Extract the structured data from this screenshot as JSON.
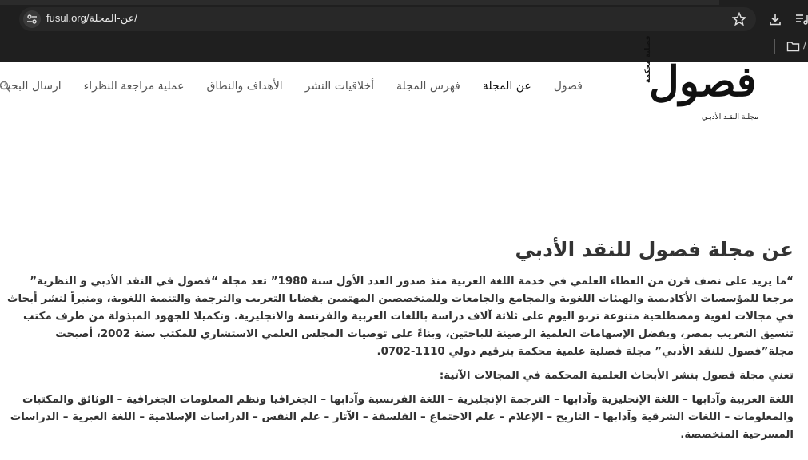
{
  "browser": {
    "url": "fusul.org/عن-المجلة/",
    "bookmark_bar_partial": "/"
  },
  "site": {
    "logo": {
      "word": "فصول",
      "badge": "فصلية محكمة",
      "subtitle": "مجلـة النقـد الأدبـي"
    },
    "nav": [
      {
        "label": "فصول",
        "active": false
      },
      {
        "label": "عن المجلة",
        "active": true
      },
      {
        "label": "فهرس المجلة",
        "active": false
      },
      {
        "label": "أخلاقيات النشر",
        "active": false
      },
      {
        "label": "الأهداف والنطاق",
        "active": false
      },
      {
        "label": "عملية مراجعة النظراء",
        "active": false
      },
      {
        "label": "ارسال البحث",
        "active": false
      }
    ]
  },
  "article": {
    "title": "عن مجلة فصول للنقد الأدبي",
    "intro": "“ما يزيد على نصف قرن من العطاء العلمي في خدمة اللغة العربية منذ صدور العدد الأول سنة 1980” تعد مجلة “فصول في النقد الأدبي و النظرية” مرجعا للمؤسسات الأكاديمية والهيئات اللغوية والمجامع والجامعات وللمتخصصين المهتمين بقضايا التعريب والترجمة والتنمية اللغوية، ومنبراً لنشر أبحاث في مجالات لغوية ومصطلحية متنوعة تربو اليوم على ثلاثة آلاف دراسة باللغات العربية والفرنسة والانجليزية. وتكميلا للجهود المبذولة من طرف مكتب تنسيق التعريب بمصر، وبفضل الإسهامات العلمية الرصينة للباحثين، وبناءً على توصيات المجلس العلمي الاستشاري للمكتب سنة 2002، أصبحت مجلة”فصول للنقد الأدبي” مجلة فصلية علمية محكمة بترقيم دولي 1110-0702.",
    "fields_heading": "تعني مجلة فصول بنشر الأبحاث العلمية المحكمة في المجالات الآتية:",
    "fields": "اللغة العربية وآدابها – اللغة الإنجليزية وآدابها – الترجمة الإنجليزية – اللغة الفرنسية وآدابها – الجغرافيا ونظم المعلومات الجغرافية – الوثائق والمكتبات والمعلومات – اللغات الشرقية وآدابها – التاريخ – الإعلام – علم الاجتماع – الفلسفة – الآثار – علم النفس – الدراسات الإسلامية – اللغة العبرية – الدراسات المسرحية المتخصصة."
  }
}
